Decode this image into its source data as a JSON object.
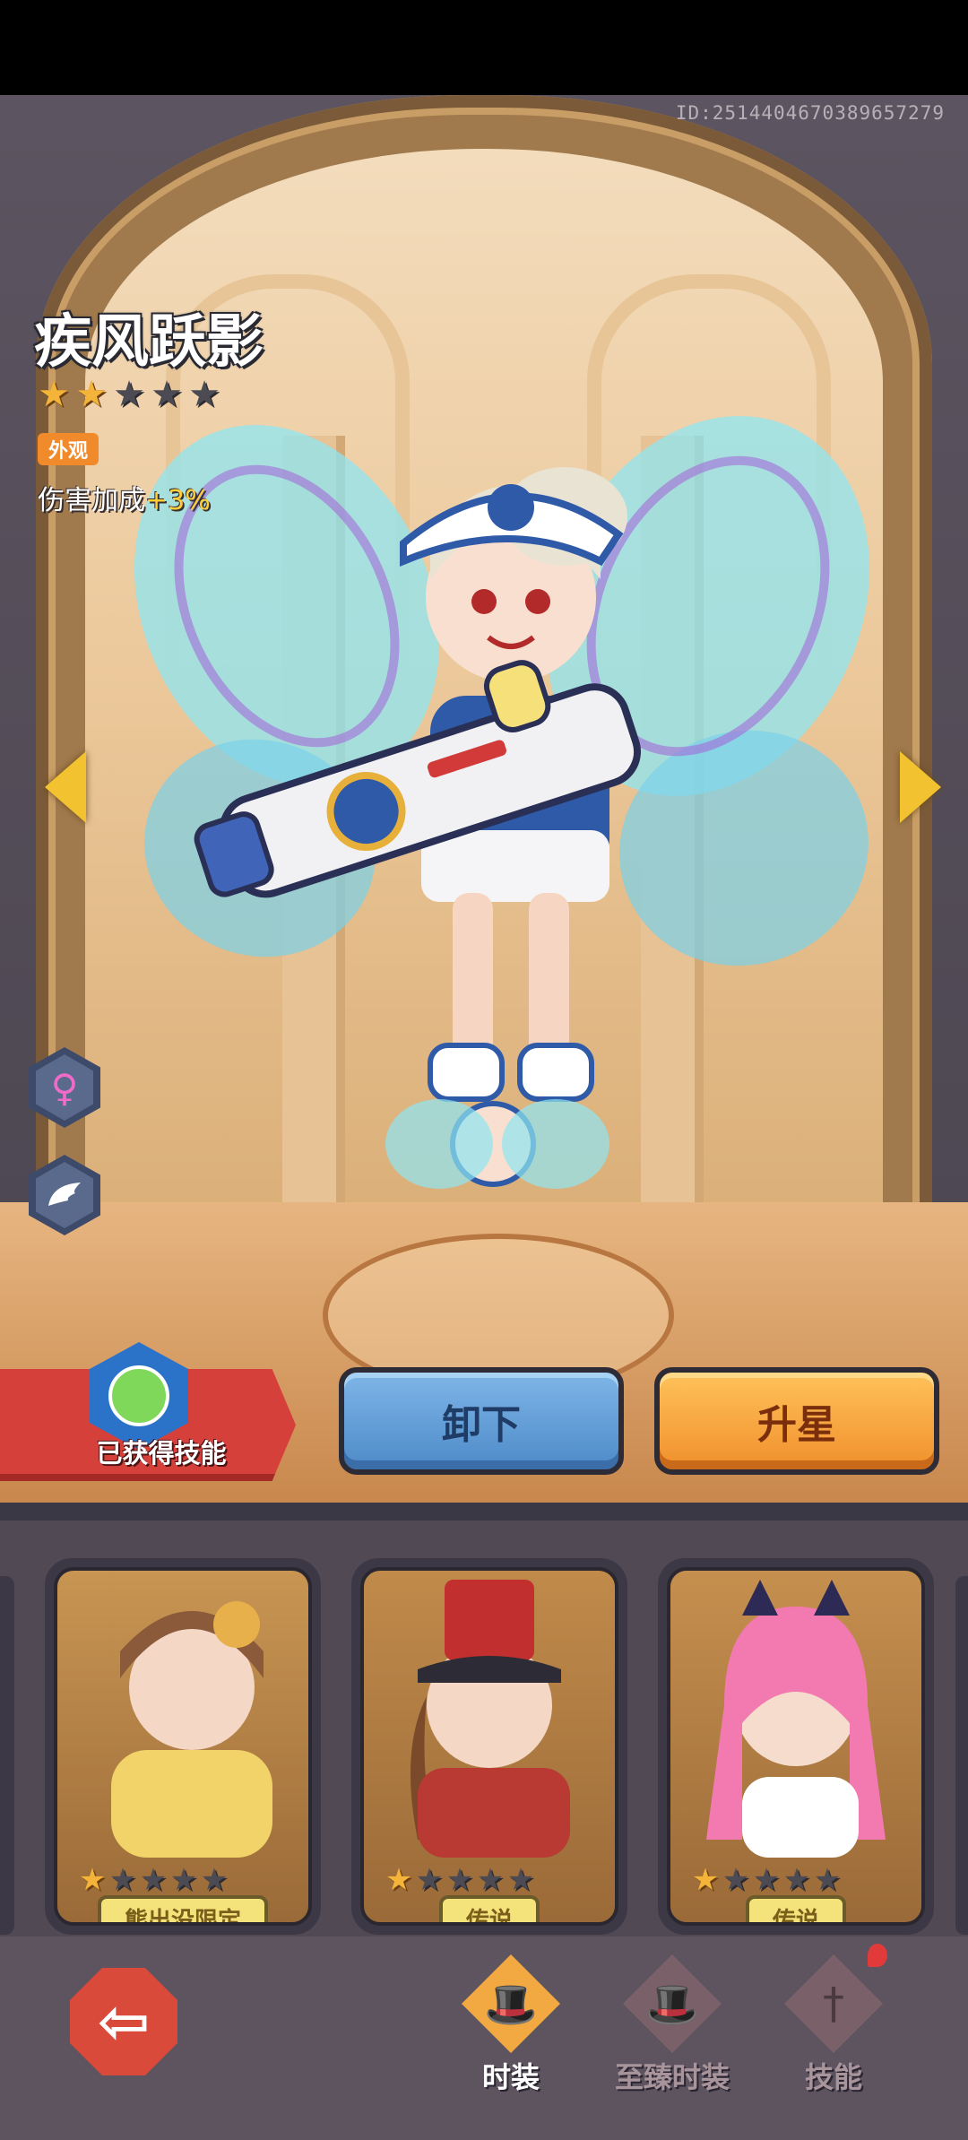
{
  "header": {
    "id_text": "ID:2514404670389657279"
  },
  "skin": {
    "name": "疾风跃影",
    "stars_filled": 2,
    "stars_total": 5,
    "tag": "外观",
    "bonus_label": "伤害加成",
    "bonus_value": "+3%"
  },
  "side_icons": [
    "female-icon",
    "wing-icon"
  ],
  "skill_banner": {
    "label": "已获得技能"
  },
  "actions": {
    "unequip_label": "卸下",
    "star_up_label": "升星"
  },
  "cards": [
    {
      "stars_filled": 1,
      "stars_total": 5,
      "badge": "熊出没限定",
      "bg": "#c89552"
    },
    {
      "stars_filled": 1,
      "stars_total": 5,
      "badge": "传说",
      "bg": "#c08a4a"
    },
    {
      "stars_filled": 1,
      "stars_total": 5,
      "badge": "传说",
      "bg": "#c58f4e"
    }
  ],
  "nav": {
    "back_icon": "back-arrow-icon",
    "tabs": [
      {
        "label": "时装",
        "icon": "hat-icon",
        "active": true
      },
      {
        "label": "至臻时装",
        "icon": "top-hat-icon",
        "active": false
      },
      {
        "label": "技能",
        "icon": "sword-icon",
        "active": false
      }
    ]
  },
  "colors": {
    "star_on": "#f4b43a",
    "star_off": "#4c4a52",
    "accent_orange": "#f08f2c",
    "accent_blue": "#4d8ac8",
    "ribbon_red": "#d6403a"
  }
}
